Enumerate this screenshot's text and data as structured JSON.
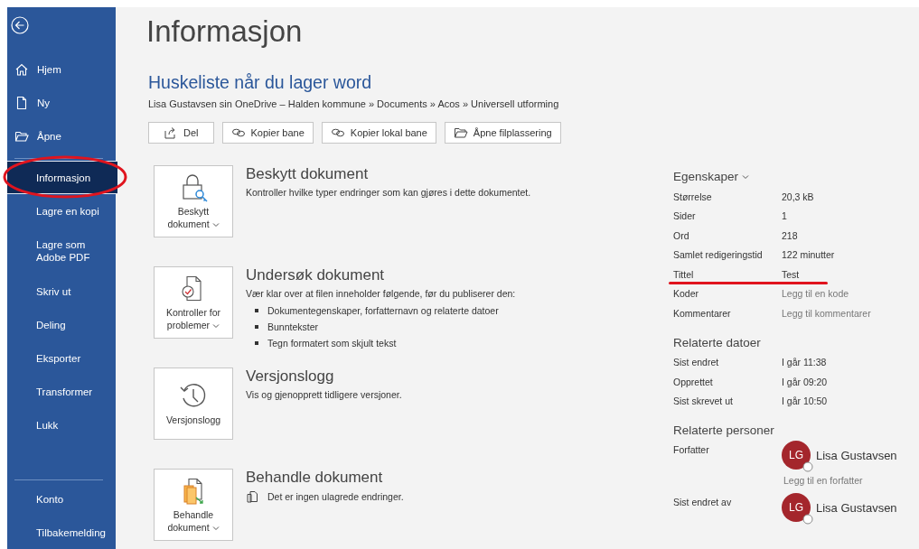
{
  "sidebar": {
    "top_items": [
      {
        "label": "Hjem",
        "selected": false,
        "circled": false
      },
      {
        "label": "Ny",
        "selected": false,
        "circled": false
      },
      {
        "label": "Åpne",
        "selected": false,
        "circled": false
      }
    ],
    "middle_items": [
      {
        "label": "Informasjon",
        "selected": true,
        "circled": true
      },
      {
        "label": "Lagre en kopi",
        "selected": false,
        "circled": false
      },
      {
        "label": "Lagre som\nAdobe PDF",
        "selected": false,
        "circled": false
      },
      {
        "label": "Skriv ut",
        "selected": false,
        "circled": false
      },
      {
        "label": "Deling",
        "selected": false,
        "circled": false
      },
      {
        "label": "Eksporter",
        "selected": false,
        "circled": false
      },
      {
        "label": "Transformer",
        "selected": false,
        "circled": false
      },
      {
        "label": "Lukk",
        "selected": false,
        "circled": false
      }
    ],
    "bottom_items": [
      {
        "label": "Konto",
        "selected": false,
        "circled": false
      },
      {
        "label": "Tilbakemelding",
        "selected": false,
        "circled": false
      }
    ]
  },
  "page_title": "Informasjon",
  "document": {
    "title": "Huskeliste når du lager word",
    "path": "Lisa Gustavsen sin OneDrive – Halden kommune » Documents » Acos » Universell utforming"
  },
  "actions": [
    "Del",
    "Kopier bane",
    "Kopier lokal bane",
    "Åpne filplassering"
  ],
  "sections": [
    {
      "tile_label": "Beskytt\ndokument",
      "tile_dropdown": true,
      "heading": "Beskytt dokument",
      "description": "Kontroller hvilke typer endringer som kan gjøres i dette dokumentet."
    },
    {
      "tile_label": "Kontroller for\nproblemer",
      "tile_dropdown": true,
      "heading": "Undersøk dokument",
      "description": "Vær klar over at filen inneholder følgende, før du publiserer den:",
      "bullets": [
        "Dokumentegenskaper, forfatternavn og relaterte datoer",
        "Bunntekster",
        "Tegn formatert som skjult tekst"
      ]
    },
    {
      "tile_label": "Versjonslogg",
      "tile_dropdown": false,
      "heading": "Versjonslogg",
      "description": "Vis og gjenopprett tidligere versjoner."
    },
    {
      "tile_label": "Behandle\ndokument",
      "tile_dropdown": true,
      "heading": "Behandle dokument",
      "description": "Det er ingen ulagrede endringer."
    }
  ],
  "properties": {
    "heading": "Egenskaper",
    "rows": [
      {
        "label": "Størrelse",
        "value": "20,3 kB",
        "underlined": false
      },
      {
        "label": "Sider",
        "value": "1",
        "underlined": false
      },
      {
        "label": "Ord",
        "value": "218",
        "underlined": false
      },
      {
        "label": "Samlet redigeringstid",
        "value": "122 minutter",
        "underlined": false
      },
      {
        "label": "Tittel",
        "value": "Test",
        "underlined": true
      },
      {
        "label": "Koder",
        "placeholder": "Legg til en kode",
        "underlined": false
      },
      {
        "label": "Kommentarer",
        "placeholder": "Legg til kommentarer",
        "underlined": false
      }
    ]
  },
  "related_dates": {
    "heading": "Relaterte datoer",
    "rows": [
      {
        "label": "Sist endret",
        "value": "I går 11:38"
      },
      {
        "label": "Opprettet",
        "value": "I går 09:20"
      },
      {
        "label": "Sist skrevet ut",
        "value": "I går 10:50"
      }
    ]
  },
  "related_people": {
    "heading": "Relaterte personer",
    "rows": [
      {
        "label": "Forfatter",
        "initials": "LG",
        "name": "Lisa Gustavsen",
        "add_link": "Legg til en forfatter"
      },
      {
        "label": "Sist endret av",
        "initials": "LG",
        "name": "Lisa Gustavsen"
      }
    ]
  }
}
